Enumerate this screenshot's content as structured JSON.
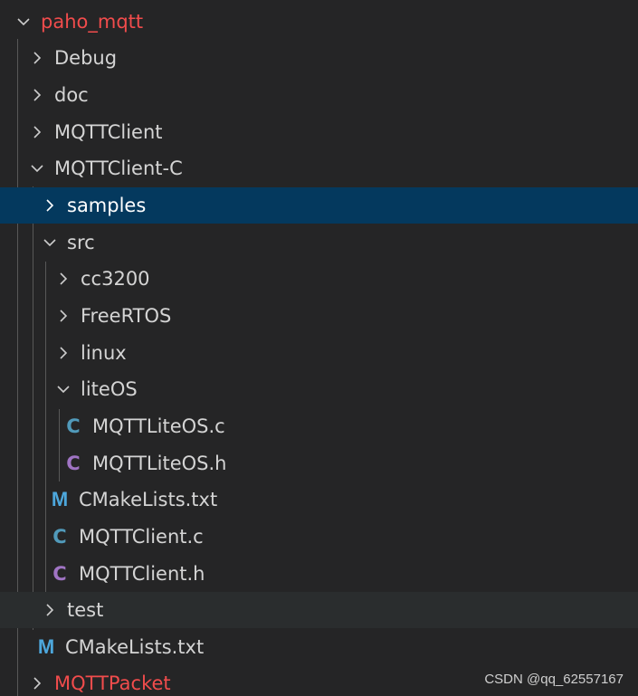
{
  "explorer": {
    "root": {
      "label": "paho_mqtt",
      "expanded": true,
      "git_status_color": "#f14c4c"
    },
    "items": [
      {
        "label": "Debug",
        "type": "folder",
        "expanded": false
      },
      {
        "label": "doc",
        "type": "folder",
        "expanded": false
      },
      {
        "label": "MQTTClient",
        "type": "folder",
        "expanded": false
      },
      {
        "label": "MQTTClient-C",
        "type": "folder",
        "expanded": true
      },
      {
        "label": "samples",
        "type": "folder",
        "expanded": false,
        "selected": true
      },
      {
        "label": "src",
        "type": "folder",
        "expanded": true
      },
      {
        "label": "cc3200",
        "type": "folder",
        "expanded": false
      },
      {
        "label": "FreeRTOS",
        "type": "folder",
        "expanded": false
      },
      {
        "label": "linux",
        "type": "folder",
        "expanded": false
      },
      {
        "label": "liteOS",
        "type": "folder",
        "expanded": true
      },
      {
        "label": "MQTTLiteOS.c",
        "type": "file",
        "icon": "c-file-icon",
        "icon_glyph": "C"
      },
      {
        "label": "MQTTLiteOS.h",
        "type": "file",
        "icon": "h-file-icon",
        "icon_glyph": "C"
      },
      {
        "label": "CMakeLists.txt",
        "type": "file",
        "icon": "cmake-file-icon",
        "icon_glyph": "M"
      },
      {
        "label": "MQTTClient.c",
        "type": "file",
        "icon": "c-file-icon",
        "icon_glyph": "C"
      },
      {
        "label": "MQTTClient.h",
        "type": "file",
        "icon": "h-file-icon",
        "icon_glyph": "C"
      },
      {
        "label": "test",
        "type": "folder",
        "expanded": false
      },
      {
        "label": "CMakeLists.txt",
        "type": "file",
        "icon": "cmake-file-icon",
        "icon_glyph": "M"
      },
      {
        "label": "MQTTPacket",
        "type": "folder",
        "expanded": false
      }
    ]
  },
  "colors": {
    "background": "#252526",
    "selection": "#04395e",
    "text": "#d4d4d4",
    "git_modified": "#f14c4c",
    "c_icon": "#519aba",
    "h_icon": "#a074c4",
    "cmake_icon": "#4da7dc"
  },
  "watermark": "CSDN @qq_62557167"
}
